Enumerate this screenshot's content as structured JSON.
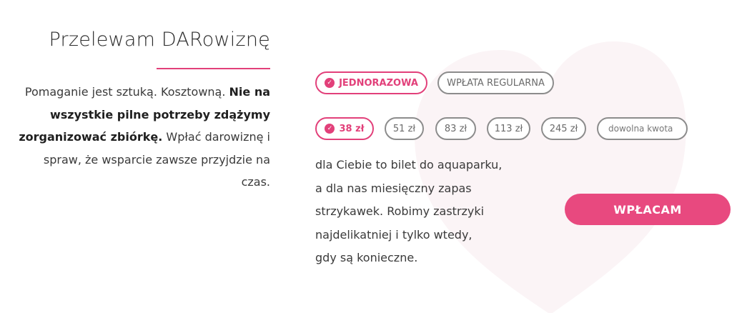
{
  "header": {
    "title": "Przelewam DARowiznę"
  },
  "intro": {
    "part1": "Pomaganie jest sztuką. Kosztowną. ",
    "bold": "Nie na wszystkie pilne potrzeby zdążymy zorganizować zbiórkę.",
    "part2": " Wpłać darowiznę i spraw, że wsparcie zawsze przyjdzie na czas."
  },
  "frequency": {
    "options": [
      {
        "label": "JEDNORAZOWA",
        "selected": true
      },
      {
        "label": "WPŁATA REGULARNA",
        "selected": false
      }
    ]
  },
  "amounts": {
    "options": [
      {
        "label": "38 zł",
        "selected": true
      },
      {
        "label": "51 zł",
        "selected": false
      },
      {
        "label": "83 zł",
        "selected": false
      },
      {
        "label": "113 zł",
        "selected": false
      },
      {
        "label": "245 zł",
        "selected": false
      }
    ],
    "custom_placeholder": "dowolna kwota"
  },
  "description": [
    "dla Ciebie to bilet do aquaparku,",
    "a dla nas miesięczny zapas",
    "strzykawek. Robimy zastrzyki",
    "najdelikatniej i tylko wtedy,",
    "gdy są konieczne."
  ],
  "donate_button": {
    "label": "WPŁACAM"
  },
  "colors": {
    "accent": "#e2407a",
    "button": "#e8497f",
    "heart": "#fbf4f6",
    "pill_border": "#8c8c8c"
  },
  "icons": {
    "selected_check": "check-circle-icon"
  }
}
